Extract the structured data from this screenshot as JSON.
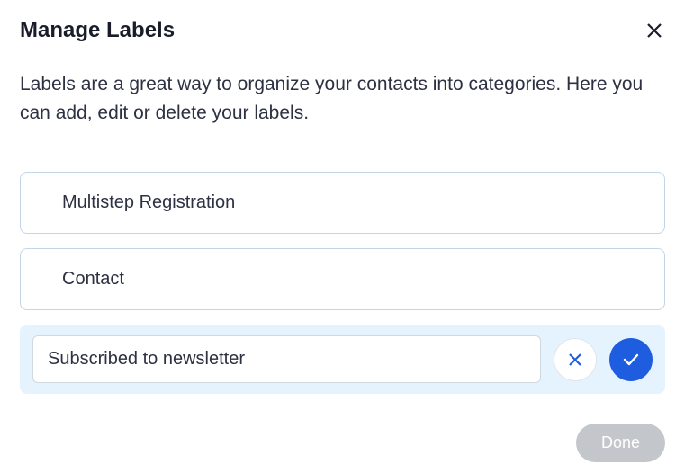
{
  "dialog": {
    "title": "Manage Labels",
    "description": "Labels are a great way to organize your contacts into categories. Here you can add, edit or delete your labels."
  },
  "labels": {
    "items": [
      {
        "name": "Multistep Registration"
      },
      {
        "name": "Contact"
      }
    ],
    "editing": {
      "value": "Subscribed to newsletter"
    }
  },
  "actions": {
    "done": "Done"
  }
}
